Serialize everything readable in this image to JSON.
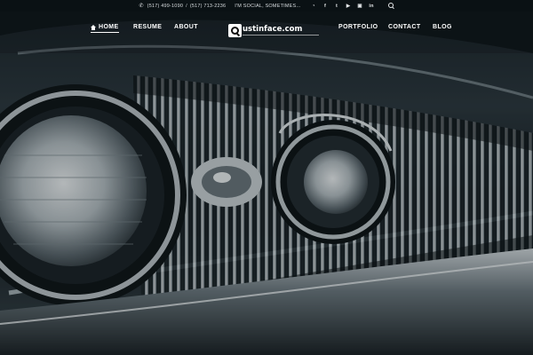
{
  "topbar": {
    "phone1": "(517) 499-1090",
    "separator": "/",
    "phone2": "(517) 713-2236",
    "tagline": "I'M SOCIAL, SOMETIMES...",
    "social_icons": [
      {
        "name": "rss-icon",
        "glyph": "◔"
      },
      {
        "name": "facebook-icon",
        "glyph": "f"
      },
      {
        "name": "twitter-icon",
        "glyph": "t"
      },
      {
        "name": "youtube-icon",
        "glyph": "▶"
      },
      {
        "name": "instagram-icon",
        "glyph": "▣"
      },
      {
        "name": "linkedin-icon",
        "glyph": "in"
      }
    ]
  },
  "nav": {
    "left": [
      {
        "label": "HOME",
        "active": true
      },
      {
        "label": "RESUME",
        "active": false
      },
      {
        "label": "ABOUT",
        "active": false
      }
    ],
    "right": [
      {
        "label": "PORTFOLIO",
        "active": false
      },
      {
        "label": "CONTACT",
        "active": false
      },
      {
        "label": "BLOG",
        "active": false
      }
    ]
  },
  "logo": {
    "name": "ustinface.com"
  },
  "colors": {
    "overlay": "#1c2328",
    "chrome_light": "#e9eef0",
    "chrome_dark": "#0d1114",
    "accent": "#ffffff"
  }
}
